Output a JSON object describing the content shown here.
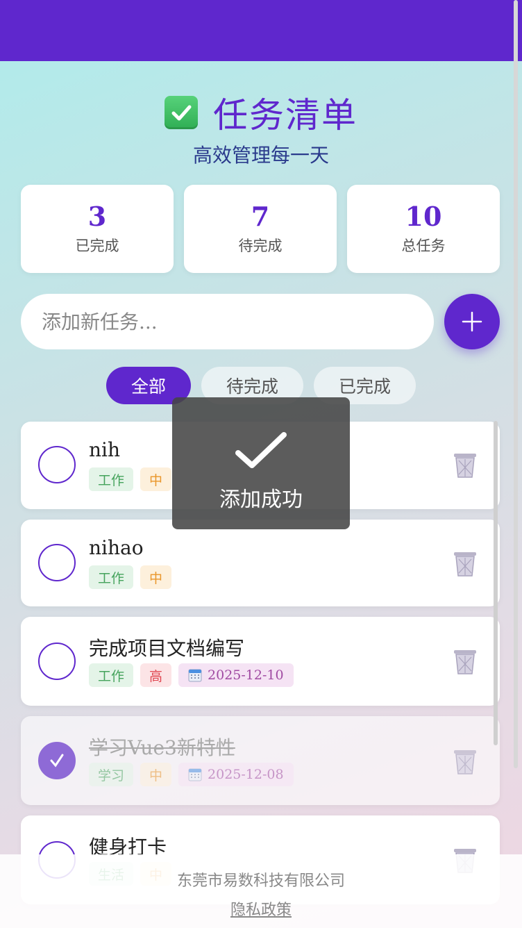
{
  "header": {
    "title": "任务清单",
    "subtitle": "高效管理每一天"
  },
  "stats": [
    {
      "value": "3",
      "label": "已完成"
    },
    {
      "value": "7",
      "label": "待完成"
    },
    {
      "value": "10",
      "label": "总任务"
    }
  ],
  "add": {
    "placeholder": "添加新任务..."
  },
  "filters": [
    "全部",
    "待完成",
    "已完成"
  ],
  "tasks": [
    {
      "title": "nih",
      "category": "工作",
      "priority": "中",
      "done": false
    },
    {
      "title": "nihao",
      "category": "工作",
      "priority": "中",
      "done": false
    },
    {
      "title": "完成项目文档编写",
      "category": "工作",
      "priority": "高",
      "date": "2025-12-10",
      "done": false
    },
    {
      "title": "学习Vue3新特性",
      "category": "学习",
      "priority": "中",
      "date": "2025-12-08",
      "done": true
    },
    {
      "title": "健身打卡",
      "category": "生活",
      "priority": "中",
      "done": false
    }
  ],
  "toast": {
    "text": "添加成功"
  },
  "footer": {
    "company": "东莞市易数科技有限公司",
    "privacy": "隐私政策"
  },
  "colors": {
    "primary": "#5f27cd",
    "high": "#e0454f",
    "medium": "#e9962b",
    "work": "#45a35c"
  }
}
